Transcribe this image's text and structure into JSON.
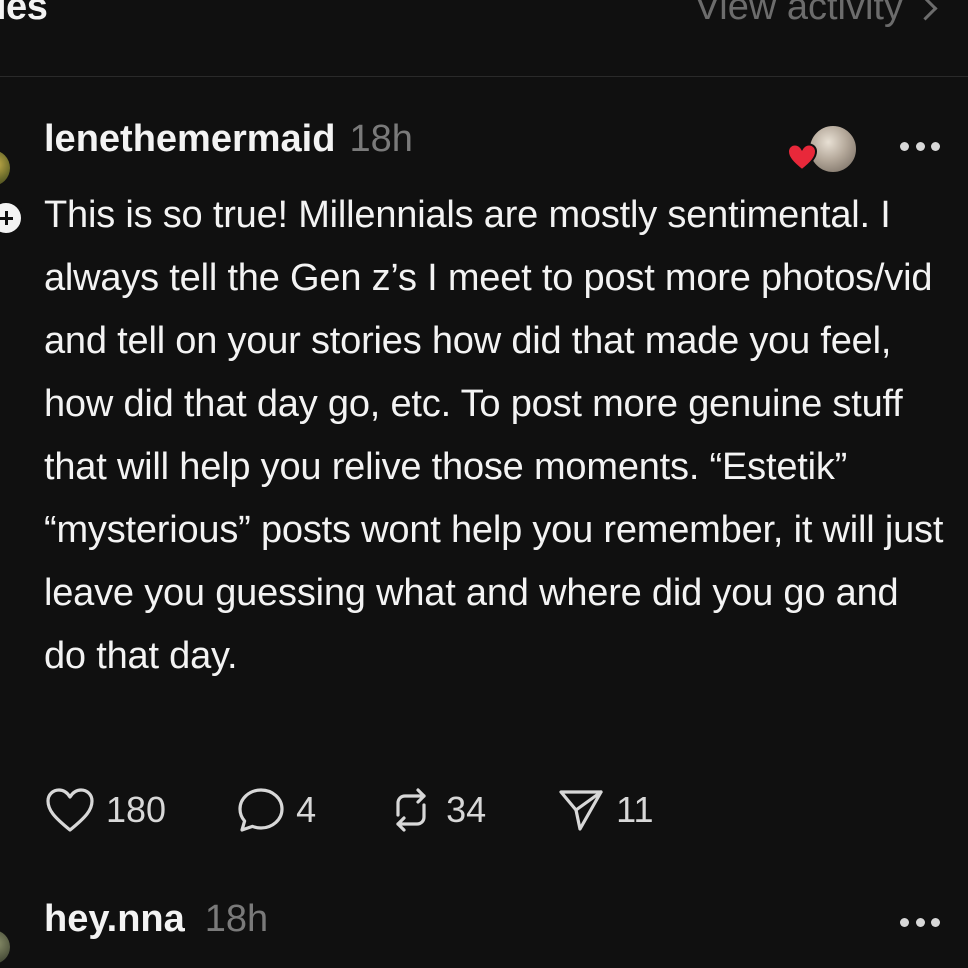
{
  "header": {
    "section_title": "ies",
    "view_activity_label": "View activity"
  },
  "post": {
    "username": "lenethemermaid",
    "timestamp": "18h",
    "body": "This is so true! Millennials are mostly sentimental. I always tell the Gen z’s I meet to post more photos/vid and tell on your stories how did that made you feel, how did that day go, etc. To post more genuine stuff that will help you relive those moments. “Estetik” “mysterious” posts wont help you remember, it will just leave you guessing what and where did you go and do that day.",
    "actions": {
      "likes": "180",
      "replies": "4",
      "reposts": "34",
      "shares": "11"
    }
  },
  "next_post": {
    "username": "hey.nna",
    "timestamp": "18h"
  },
  "icons": {
    "heart": "heart-icon",
    "reply": "speech-bubble-icon",
    "repost": "repost-icon",
    "share": "paper-plane-icon",
    "more": "more-dots-icon"
  },
  "colors": {
    "background": "#101010",
    "text": "#f3f3f3",
    "muted": "#7a7a7a",
    "like_red": "#e8283a"
  }
}
